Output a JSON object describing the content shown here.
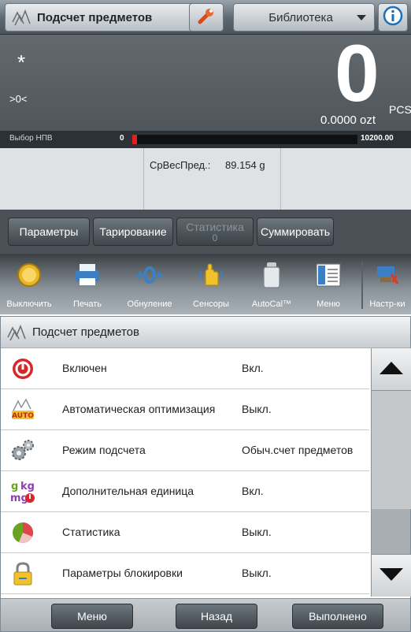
{
  "top_screen": {
    "app_selector": {
      "label": "Подсчет предметов",
      "icon": "parts-counting-icon"
    },
    "settings_icon": "wrench-icon",
    "library_selector": {
      "label": "Библиотека"
    },
    "info_icon": "info-icon",
    "stability_indicator": "*",
    "zero_indicator": ">0<",
    "reading": {
      "value": "0",
      "unit": "PCS",
      "secondary": "0.0000 ozt"
    },
    "capacity": {
      "label": "Выбор НПВ",
      "min": "0",
      "max": "10200.00",
      "fill_fraction": 0.02
    },
    "reference": {
      "label": "СрВесПред.:",
      "value": "89.154 g"
    },
    "softkeys": [
      {
        "label": "Параметры",
        "enabled": true
      },
      {
        "label": "Тарирование",
        "enabled": true
      },
      {
        "label": "Статистика",
        "sub": "0",
        "enabled": false
      },
      {
        "label": "Суммировать",
        "enabled": true
      }
    ],
    "toolbar": [
      {
        "label": "Выключить",
        "icon": "power-off-icon"
      },
      {
        "label": "Печать",
        "icon": "printer-icon"
      },
      {
        "label": "Обнуление",
        "icon": "zero-icon"
      },
      {
        "label": "Сенсоры",
        "icon": "sensor-hand-icon"
      },
      {
        "label": "AutoCal™",
        "icon": "autocal-weight-icon"
      },
      {
        "label": "Меню",
        "icon": "menu-icon"
      },
      {
        "label": "Настр-ки",
        "icon": "settings-icon"
      }
    ],
    "colors": {
      "capacity_fill": "#e02020",
      "background": "#4a4a4a"
    }
  },
  "bottom_screen": {
    "title": "Подсчет предметов",
    "title_icon": "parts-counting-icon",
    "items": [
      {
        "label": "Включен",
        "value": "Вкл.",
        "icon": "power-icon"
      },
      {
        "label": "Автоматическая оптимизация",
        "value": "Выкл.",
        "icon": "auto-optimization-icon"
      },
      {
        "label": "Режим подсчета",
        "value": "Обыч.счет предметов",
        "icon": "gears-icon"
      },
      {
        "label": "Дополнительная единица",
        "value": "Вкл.",
        "icon": "units-icon"
      },
      {
        "label": "Статистика",
        "value": "Выкл.",
        "icon": "statistics-pie-icon"
      },
      {
        "label": "Параметры блокировки",
        "value": "Выкл.",
        "icon": "lock-icon"
      }
    ],
    "footer": {
      "menu": "Меню",
      "back": "Назад",
      "done": "Выполнено"
    }
  }
}
